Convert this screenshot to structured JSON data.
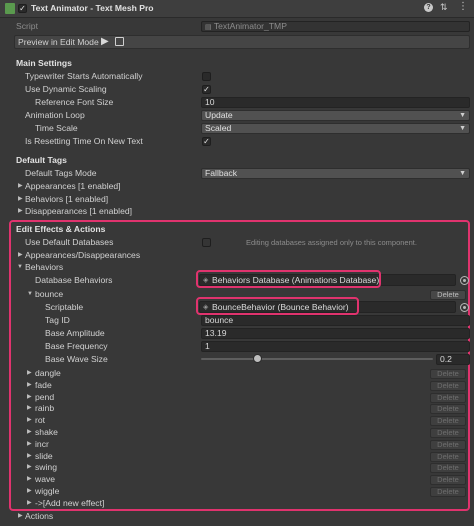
{
  "header": {
    "component_title": "Text Animator - Text Mesh Pro",
    "script_label": "Script",
    "script_value": "TextAnimator_TMP",
    "preview_label": "Preview in Edit Mode"
  },
  "main_settings": {
    "title": "Main Settings",
    "typewriter_label": "Typewriter Starts Automatically",
    "typewriter_checked": false,
    "dynamic_scaling_label": "Use Dynamic Scaling",
    "dynamic_scaling_checked": true,
    "ref_font_size_label": "Reference Font Size",
    "ref_font_size_value": "10",
    "animation_loop_label": "Animation Loop",
    "animation_loop_value": "Update",
    "time_scale_label": "Time Scale",
    "time_scale_value": "Scaled",
    "resetting_label": "Is Resetting Time On New Text",
    "resetting_checked": true
  },
  "default_tags": {
    "title": "Default Tags",
    "mode_label": "Default Tags Mode",
    "mode_value": "Fallback",
    "appearances": "Appearances [1 enabled]",
    "behaviors": "Behaviors [1 enabled]",
    "disappearances": "Disappearances [1 enabled]"
  },
  "edit_effects": {
    "title": "Edit Effects & Actions",
    "use_default_db_label": "Use Default Databases",
    "use_default_db_checked": false,
    "db_note": "Editing databases assigned only to this component.",
    "appearances_disappearances": "Appearances/Disappearances",
    "behaviors_label": "Behaviors",
    "database_behaviors_label": "Database Behaviors",
    "database_behaviors_value": "Behaviors Database (Animations Database)",
    "bounce": {
      "name": "bounce",
      "delete_label": "Delete",
      "scriptable_label": "Scriptable",
      "scriptable_value": "BounceBehavior (Bounce Behavior)",
      "tag_id_label": "Tag ID",
      "tag_id_value": "bounce",
      "amplitude_label": "Base Amplitude",
      "amplitude_value": "13.19",
      "frequency_label": "Base Frequency",
      "frequency_value": "1",
      "wave_size_label": "Base Wave Size",
      "wave_size_value": "0.2",
      "wave_size_slider_fraction": 0.24
    },
    "effects": [
      {
        "name": "dangle",
        "delete": "Delete"
      },
      {
        "name": "fade",
        "delete": "Delete"
      },
      {
        "name": "pend",
        "delete": "Delete"
      },
      {
        "name": "rainb",
        "delete": "Delete"
      },
      {
        "name": "rot",
        "delete": "Delete"
      },
      {
        "name": "shake",
        "delete": "Delete"
      },
      {
        "name": "incr",
        "delete": "Delete"
      },
      {
        "name": "slide",
        "delete": "Delete"
      },
      {
        "name": "swing",
        "delete": "Delete"
      },
      {
        "name": "wave",
        "delete": "Delete"
      },
      {
        "name": "wiggle",
        "delete": "Delete"
      }
    ],
    "add_new_effect": "->[Add new effect]",
    "actions": "Actions"
  },
  "colors": {
    "background": "#383838",
    "highlight": "#e0336e",
    "field": "#2a2a2a"
  }
}
